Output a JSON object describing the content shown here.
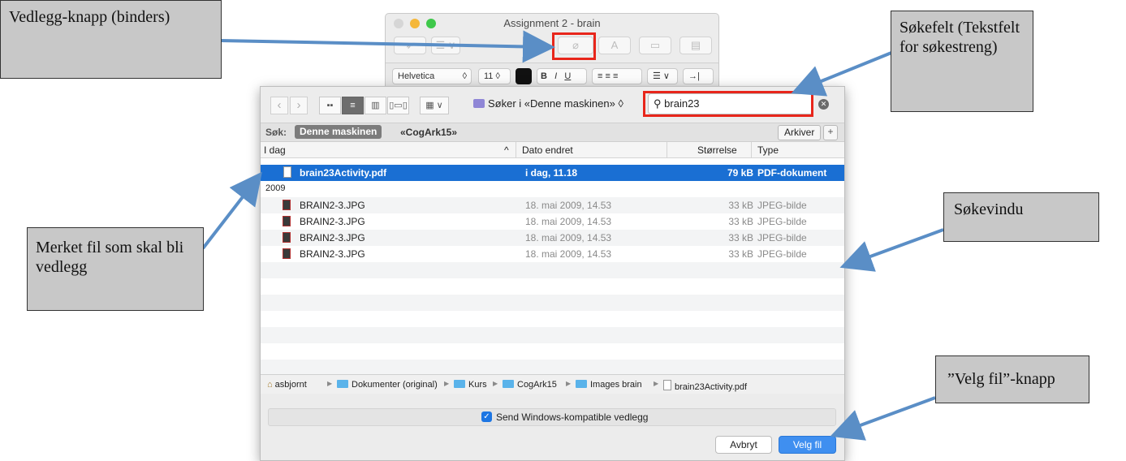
{
  "mail_window": {
    "title": "Assignment 2 - brain",
    "toolbar": {
      "attach_icon": "paperclip-icon",
      "font_button": "A",
      "list_toggle": "☰ ∨"
    },
    "format_bar": {
      "font": "Helvetica",
      "size": "11",
      "bold": "B",
      "italic": "I",
      "underline": "U",
      "indent": "→| ∨"
    }
  },
  "dialog": {
    "search_scope": "Søker i «Denne maskinen»",
    "search_value": "brain23",
    "scope_bar": {
      "label": "Søk:",
      "active": "Denne maskinen",
      "alternative": "«CogArk15»",
      "archive_button": "Arkiver",
      "add_button": "+"
    },
    "columns": [
      "I dag",
      "Dato endret",
      "Størrelse",
      "Type"
    ],
    "selected_row": {
      "name": "brain23Activity.pdf",
      "date": "i dag, 11.18",
      "size": "79 kB",
      "type": "PDF-dokument"
    },
    "section_2009": "2009",
    "rows": [
      {
        "name": "BRAIN2-3.JPG",
        "date": "18. mai 2009, 14.53",
        "size": "33 kB",
        "type": "JPEG-bilde"
      },
      {
        "name": "BRAIN2-3.JPG",
        "date": "18. mai 2009, 14.53",
        "size": "33 kB",
        "type": "JPEG-bilde"
      },
      {
        "name": "BRAIN2-3.JPG",
        "date": "18. mai 2009, 14.53",
        "size": "33 kB",
        "type": "JPEG-bilde"
      },
      {
        "name": "BRAIN2-3.JPG",
        "date": "18. mai 2009, 14.53",
        "size": "33 kB",
        "type": "JPEG-bilde"
      }
    ],
    "path": [
      "asbjornt",
      "Dokumenter (original)",
      "Kurs",
      "CogArk15",
      "Images brain",
      "brain23Activity.pdf"
    ],
    "option_label": "Send Windows-kompatible vedlegg",
    "cancel_label": "Avbryt",
    "choose_label": "Velg fil"
  },
  "annotations": {
    "attach": "Vedlegg-knapp (binders)",
    "search_field": "Søkefelt (Tekstfelt for søkestreng)",
    "marked_file": "Merket fil som skal bli vedlegg",
    "search_window": "Søkevindu",
    "choose_button": "”Velg fil”-knapp"
  },
  "colors": {
    "selection": "#1a6fd3",
    "highlight": "#e8261b",
    "arrow": "#5a8ec6",
    "callout_bg": "#c8c8c8"
  }
}
